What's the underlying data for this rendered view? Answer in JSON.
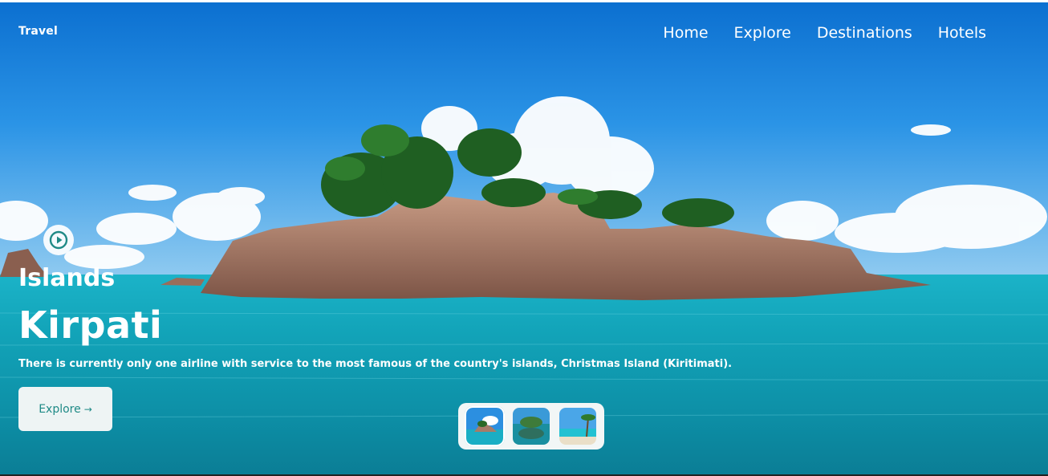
{
  "header": {
    "brand": "Travel",
    "nav": [
      "Home",
      "Explore",
      "Destinations",
      "Hotels"
    ]
  },
  "hero": {
    "subtitle": "Islands",
    "title": "Kirpati",
    "description": "There is currently only one airline with service to the most famous of the country's islands, Christmas Island (Kiritimati).",
    "button_label": "Explore",
    "button_arrow": "→"
  },
  "icons": {
    "play": "play-circle-icon"
  },
  "thumbnails": [
    {
      "name": "island-rocks"
    },
    {
      "name": "underwater-island"
    },
    {
      "name": "beach-palm"
    }
  ],
  "colors": {
    "accent": "#1f8a86",
    "sky": "#1a86d6",
    "sea": "#10a6c0"
  }
}
